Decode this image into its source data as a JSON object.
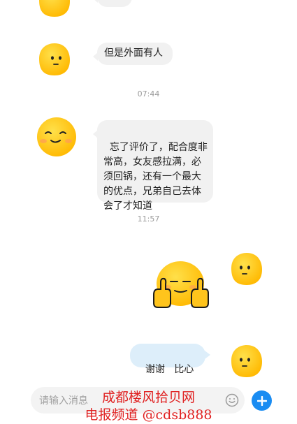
{
  "messages": [
    {
      "id": "m1",
      "text": "但是外面有人"
    },
    {
      "id": "m2",
      "text": "忘了评价了，配合度非\n常高，女友感拉满，必\n须回锅，还有一个最大\n的优点，兄弟自己去体\n会了才知道"
    },
    {
      "id": "m4",
      "text": "谢谢   比心"
    }
  ],
  "timestamps": [
    "07:44",
    "11:57"
  ],
  "input": {
    "placeholder": "请输入消息"
  },
  "icons": {
    "avatar": "yellow-blob-avatar-icon",
    "sticker": "thumbs-up-smiling-sticker",
    "emoji": "smiley-face-icon",
    "add": "plus-icon"
  },
  "colors": {
    "incoming_bubble": "#f1f1f1",
    "outgoing_bubble": "#ddeefa",
    "add_button": "#1a8cf2",
    "avatar_yellow": "#ffc41c",
    "watermark": "#e02020"
  },
  "watermark": {
    "line1": "成都楼风拾贝网",
    "line2": "电报频道 @cdsb888"
  }
}
